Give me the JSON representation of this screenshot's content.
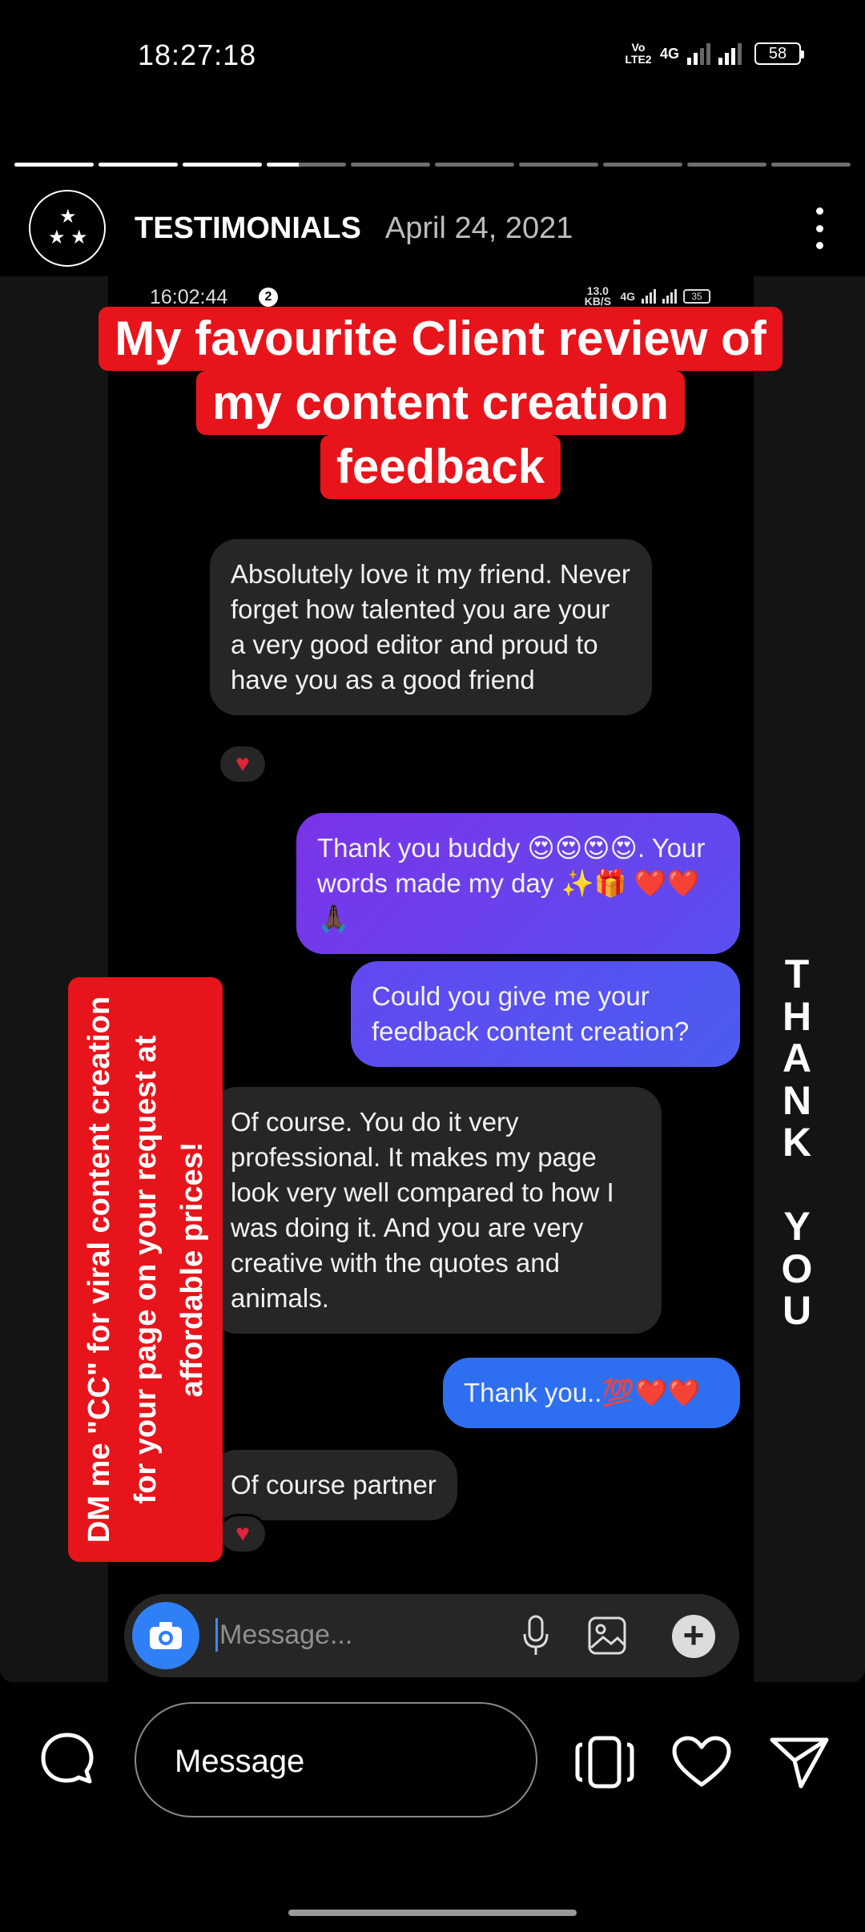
{
  "status_bar": {
    "time": "18:27:18",
    "volte": "Vo LTE2",
    "network": "4G",
    "battery": "58"
  },
  "story": {
    "segments_total": 10,
    "segments_completed": 3,
    "current_segment_progress": 0.4,
    "username": "TESTIMONIALS",
    "date": "April 24, 2021"
  },
  "screenshot": {
    "status": {
      "time": "16:02:44",
      "badge": "2",
      "speed": "13.0 KB/S",
      "network": "4G",
      "battery": "35"
    },
    "title_lines": [
      "My favourite Client review of",
      "my content creation",
      "feedback"
    ],
    "messages": [
      {
        "id": "m1",
        "dir": "in",
        "text": "Absolutely love it my friend. Never forget how talented you are your a very good editor and proud to have you as a good friend"
      },
      {
        "id": "m2",
        "dir": "out",
        "text": "Thank you buddy 😍😍😍😍. Your words made my day ✨🎁 ❤️❤️🙏🏿"
      },
      {
        "id": "m3",
        "dir": "out",
        "text": "Could you give me your feedback content creation?"
      },
      {
        "id": "m4",
        "dir": "in",
        "text": "Of course. You do it very professional. It makes my page look very well compared to how I was doing it. And you are very creative with the quotes and animals."
      },
      {
        "id": "m5",
        "dir": "out",
        "text": "Thank you..💯❤️❤️"
      },
      {
        "id": "m6",
        "dir": "in",
        "text": "Of course partner"
      }
    ],
    "banner_text": "DM me \"CC\" for viral content creation for your page on your request at affordable prices!",
    "side_text": "THANK YOU",
    "message_placeholder": "Message..."
  },
  "bottom_bar": {
    "message_placeholder": "Message"
  },
  "colors": {
    "accent_red": "#e8141b",
    "out_bubble": "#7b33e8",
    "in_bubble": "#262626",
    "blue": "#2e6ff2"
  },
  "icons": {
    "reply": "reply-bubble-icon",
    "share": "send-icon",
    "like": "heart-icon",
    "camera": "camera-icon",
    "mic": "microphone-icon",
    "gallery": "gallery-icon",
    "add": "plus-icon",
    "more": "more-vertical-icon"
  }
}
